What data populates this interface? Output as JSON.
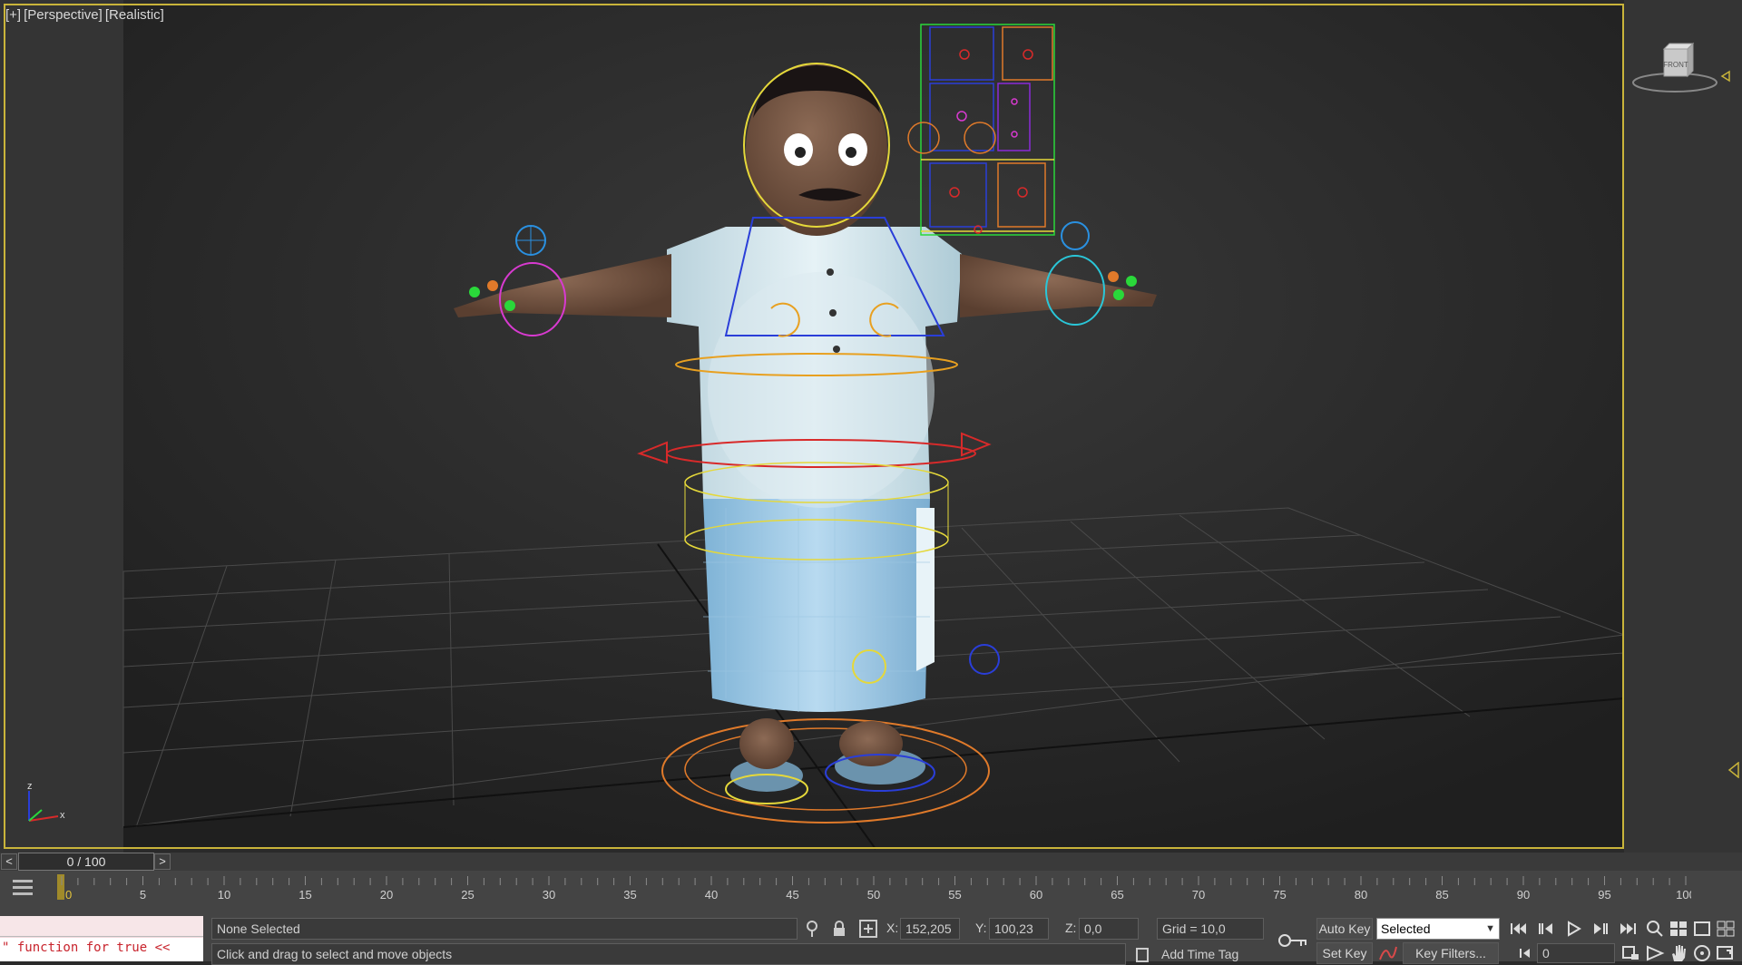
{
  "viewport": {
    "labels": [
      "[+]",
      "[Perspective]",
      "[Realistic]"
    ],
    "viewcube_label": "FRONT",
    "axis_labels": [
      "z",
      "x"
    ]
  },
  "timeline": {
    "slider_value": "0 / 100",
    "prev_label": "<",
    "next_label": ">",
    "ticks": [
      "0",
      "5",
      "10",
      "15",
      "20",
      "25",
      "30",
      "35",
      "40",
      "45",
      "50",
      "55",
      "60",
      "65",
      "70",
      "75",
      "80",
      "85",
      "90",
      "95",
      "100"
    ]
  },
  "status": {
    "maxscript_output": "\" function for true <<",
    "selection": "None Selected",
    "prompt": "Click and drag to select and move objects",
    "x_label": "X:",
    "x_value": "152,205",
    "y_label": "Y:",
    "y_value": "100,23",
    "z_label": "Z:",
    "z_value": "0,0",
    "grid": "Grid = 10,0",
    "add_time_tag": "Add Time Tag",
    "auto_key": "Auto Key",
    "set_key": "Set Key",
    "selected_option": "Selected",
    "key_filters": "Key Filters...",
    "current_frame": "0"
  },
  "colors": {
    "viewport_border": "#c9b43a",
    "maxscript_text": "#c8232c"
  }
}
